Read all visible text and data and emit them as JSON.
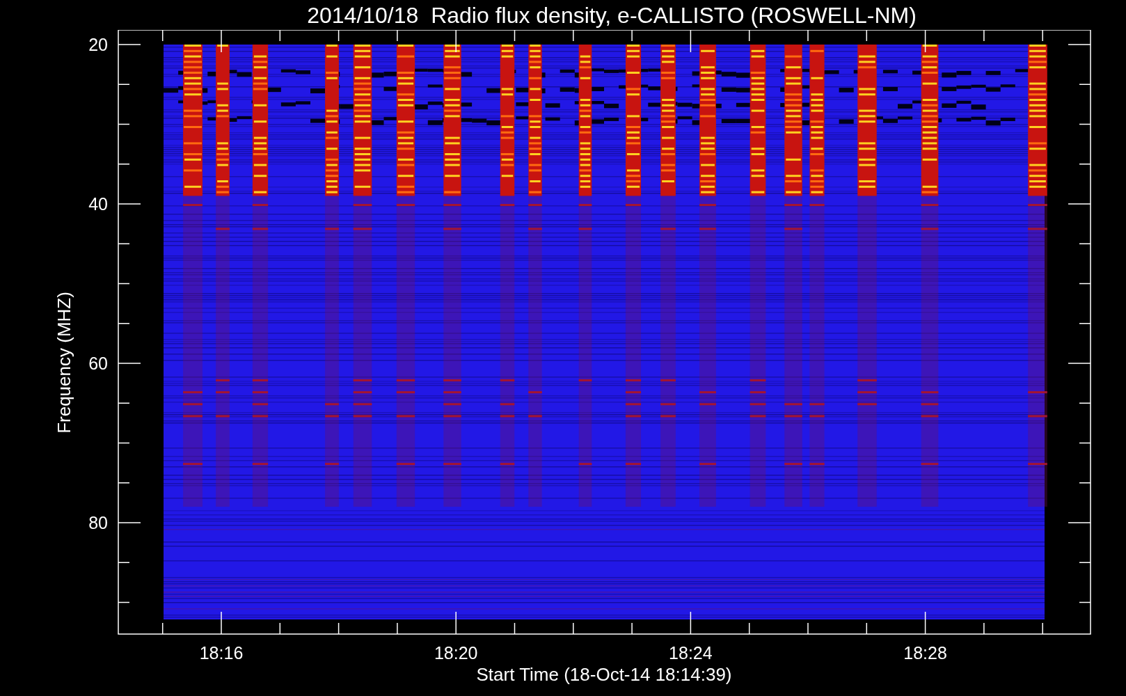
{
  "title": "2014/10/18  Radio flux density, e-CALLISTO (ROSWELL-NM)",
  "y_axis": {
    "label": "Frequency (MHZ)",
    "ticks": [
      "20",
      "40",
      "60",
      "80"
    ]
  },
  "x_axis": {
    "label": "Start Time (18-Oct-14 18:14:39)",
    "ticks": [
      "18:16",
      "18:20",
      "18:24",
      "18:28"
    ]
  }
}
